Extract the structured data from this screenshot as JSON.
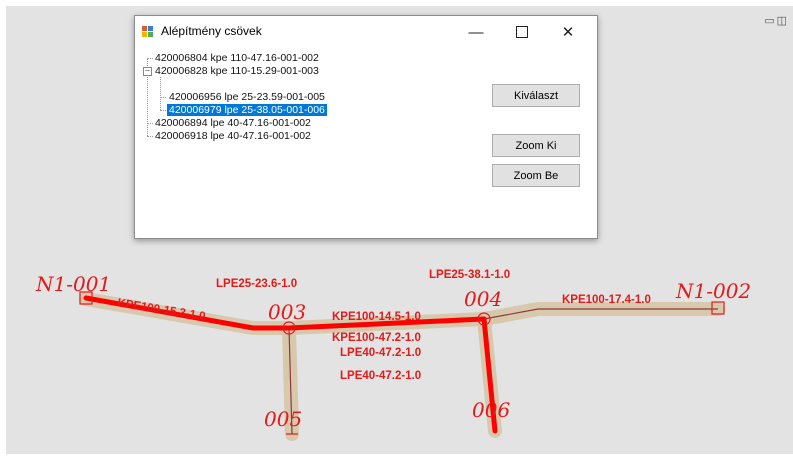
{
  "dialog": {
    "title": "Alépítmény csövek",
    "tree": [
      {
        "label": "420006804 kpe 110-47.16-001-002",
        "level": 0,
        "expanded": false,
        "selected": false
      },
      {
        "label": "420006828 kpe 110-15.29-001-003",
        "level": 0,
        "expanded": true,
        "selected": false
      },
      {
        "label": "420006956 lpe 25-23.59-001-005",
        "level": 1,
        "expanded": false,
        "selected": false
      },
      {
        "label": "420006979 lpe 25-38.05-001-006",
        "level": 1,
        "expanded": false,
        "selected": true
      },
      {
        "label": "420006894 lpe 40-47.16-001-002",
        "level": 0,
        "expanded": false,
        "selected": false
      },
      {
        "label": "420006918 lpe 40-47.16-001-002",
        "level": 0,
        "expanded": false,
        "selected": false
      }
    ],
    "buttons": {
      "select_label": "Kiválaszt",
      "zoom_out_label": "Zoom Ki",
      "zoom_in_label": "Zoom Be"
    },
    "window_buttons": {
      "minimize": "—",
      "close": "✕"
    }
  },
  "map": {
    "node_labels": [
      "N1-001",
      "003",
      "004",
      "N1-002",
      "005",
      "006"
    ],
    "pipe_labels": [
      "LPE25-23.6-1.0",
      "LPE25-38.1-1.0",
      "KPE100-15.3-1.0",
      "KPE100-14.5-1.0",
      "KPE100-17.4-1.0",
      "KPE100-47.2-1.0",
      "LPE40-47.2-1.0",
      "LPE40-47.2-1.0"
    ],
    "colors": {
      "background": "#e3e3e3",
      "highlight": "#ff0000",
      "pipe_buffer": "#d6c4a6",
      "pipe_line": "#8b3a3a",
      "node_text": "#e31a1a"
    }
  }
}
